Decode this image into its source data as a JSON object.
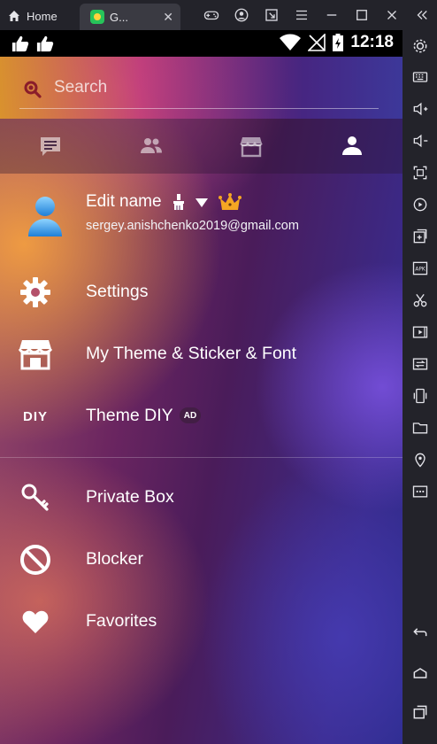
{
  "emulator": {
    "home_tab_label": "Home",
    "app_tab_label": "G...",
    "top_icons": [
      "gamepad-icon",
      "account-icon",
      "expand-icon",
      "menu-icon",
      "minimize-icon",
      "maximize-icon",
      "close-icon",
      "collapse-icon"
    ],
    "side_icons": [
      "settings-icon",
      "keyboard-icon",
      "volume-up-icon",
      "volume-down-icon",
      "screenshot-icon",
      "rotate-icon",
      "add-app-icon",
      "apk-icon",
      "cut-icon",
      "video-icon",
      "transfer-icon",
      "shake-icon",
      "folder-icon",
      "location-icon",
      "more-icon",
      "back-icon",
      "home-icon",
      "recents-icon"
    ]
  },
  "statusbar": {
    "time": "12:18"
  },
  "search": {
    "placeholder": "Search"
  },
  "tabs": [
    {
      "name": "messages",
      "icon": "message-icon",
      "active": false
    },
    {
      "name": "contacts",
      "icon": "contacts-icon",
      "active": false
    },
    {
      "name": "store",
      "icon": "store-icon",
      "active": false
    },
    {
      "name": "profile",
      "icon": "person-icon",
      "active": true
    }
  ],
  "profile": {
    "name": "Edit name",
    "email": "sergey.anishchenko2019@gmail.com"
  },
  "menu": {
    "settings": "Settings",
    "theme": "My Theme & Sticker & Font",
    "theme_diy": "Theme DIY",
    "diy_icon_text": "DIY",
    "ad_badge": "AD",
    "private_box": "Private Box",
    "blocker": "Blocker",
    "favorites": "Favorites"
  },
  "colors": {
    "accent": "#f5a623",
    "search_icon": "#8a1c2a"
  }
}
